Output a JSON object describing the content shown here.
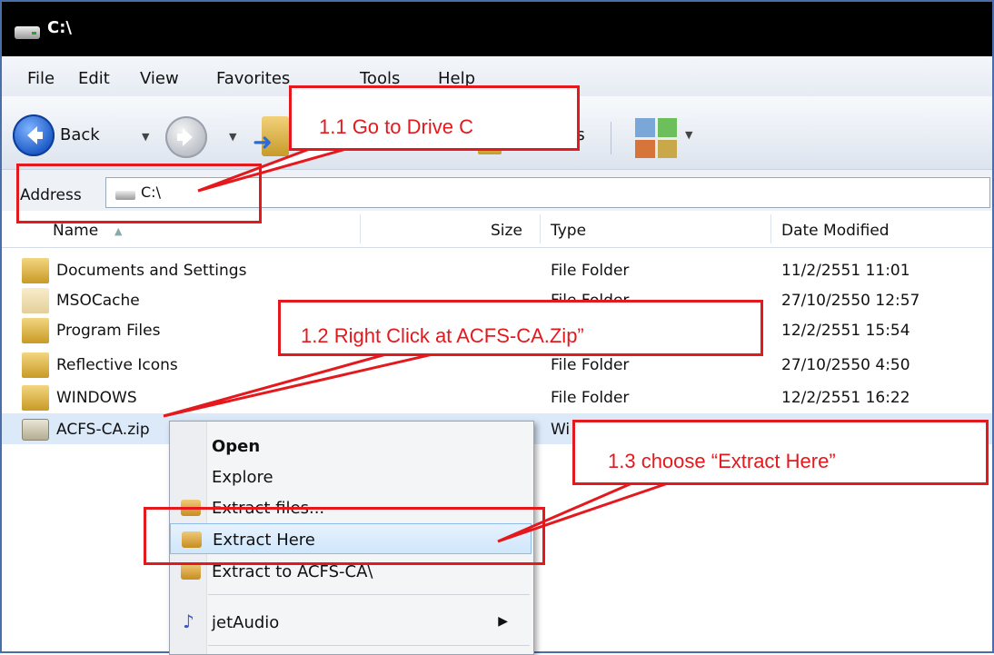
{
  "window": {
    "title": "C:\\"
  },
  "menu": [
    "File",
    "Edit",
    "View",
    "Favorites",
    "Tools",
    "Help"
  ],
  "toolbar": {
    "back_label": "Back",
    "folders_label": "rs"
  },
  "address": {
    "label": "Address",
    "value": "C:\\"
  },
  "columns": {
    "name": "Name",
    "size": "Size",
    "type": "Type",
    "date": "Date Modified"
  },
  "files": [
    {
      "name": "Documents and Settings",
      "type": "File Folder",
      "date": "11/2/2551 11:01"
    },
    {
      "name": "MSOCache",
      "type": "File Folder",
      "date": "27/10/2550 12:57"
    },
    {
      "name": "Program Files",
      "type": "File Folder",
      "date": "12/2/2551 15:54"
    },
    {
      "name": "Reflective Icons",
      "type": "File Folder",
      "date": "27/10/2550 4:50"
    },
    {
      "name": "WINDOWS",
      "type": "File Folder",
      "date": "12/2/2551 16:22"
    },
    {
      "name": "ACFS-CA.zip",
      "type": "Wi",
      "date": ""
    }
  ],
  "context_menu": {
    "open": "Open",
    "explore": "Explore",
    "extract_files": "Extract files...",
    "extract_here": "Extract Here",
    "extract_to": "Extract to ACFS-CA\\",
    "jetaudio": "jetAudio"
  },
  "callouts": {
    "step1": "1.1 Go to Drive C",
    "step2": "1.2 Right Click at ACFS-CA.Zip”",
    "step3": "1.3 choose “Extract Here”"
  },
  "annotation_color": "#e3191e"
}
